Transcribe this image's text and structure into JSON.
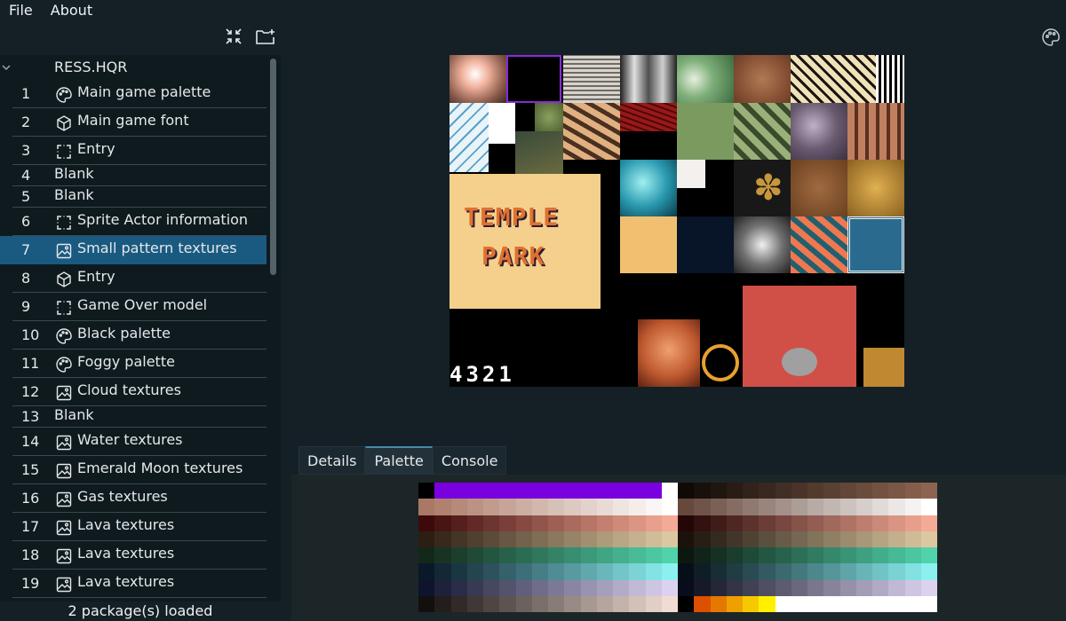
{
  "menu": {
    "file_label": "File",
    "about_label": "About"
  },
  "toolbar": {
    "collapse_icon": "collapse-icon",
    "add_folder_icon": "folder-add-icon"
  },
  "tree": {
    "root_label": "RESS.HQR",
    "items": [
      {
        "index": "1",
        "label": "Main game palette",
        "icon": "palette-icon"
      },
      {
        "index": "2",
        "label": "Main game font",
        "icon": "cube-icon"
      },
      {
        "index": "3",
        "label": "Entry",
        "icon": "dashed-box-icon"
      },
      {
        "index": "4",
        "label": "Blank",
        "icon": ""
      },
      {
        "index": "5",
        "label": "Blank",
        "icon": ""
      },
      {
        "index": "6",
        "label": "Sprite Actor information",
        "icon": "dashed-box-icon"
      },
      {
        "index": "7",
        "label": "Small pattern textures",
        "icon": "image-icon",
        "selected": true
      },
      {
        "index": "8",
        "label": "Entry",
        "icon": "cube-icon"
      },
      {
        "index": "9",
        "label": "Game Over model",
        "icon": "dashed-box-icon"
      },
      {
        "index": "10",
        "label": "Black palette",
        "icon": "palette-icon"
      },
      {
        "index": "11",
        "label": "Foggy palette",
        "icon": "palette-icon"
      },
      {
        "index": "12",
        "label": "Cloud textures",
        "icon": "image-icon"
      },
      {
        "index": "13",
        "label": "Blank",
        "icon": ""
      },
      {
        "index": "14",
        "label": "Water textures",
        "icon": "image-icon"
      },
      {
        "index": "15",
        "label": "Emerald Moon textures",
        "icon": "image-icon"
      },
      {
        "index": "16",
        "label": "Gas textures",
        "icon": "image-icon"
      },
      {
        "index": "17",
        "label": "Lava textures",
        "icon": "image-icon"
      },
      {
        "index": "18",
        "label": "Lava textures",
        "icon": "image-icon"
      },
      {
        "index": "19",
        "label": "Lava textures",
        "icon": "image-icon"
      }
    ]
  },
  "status": {
    "text": "2 package(s) loaded"
  },
  "tabs": [
    {
      "label": "Details",
      "active": false
    },
    {
      "label": "Palette",
      "active": true
    },
    {
      "label": "Console",
      "active": false
    }
  ],
  "texture_preview": {
    "title_line1": "TEMPLE",
    "title_line2": "PARK",
    "digits": "4321"
  },
  "colors": {
    "selected_row": "#1a5a80",
    "background": "#142026",
    "sidebar": "#0f1a1f",
    "accent_tab": "#4a88b0"
  }
}
